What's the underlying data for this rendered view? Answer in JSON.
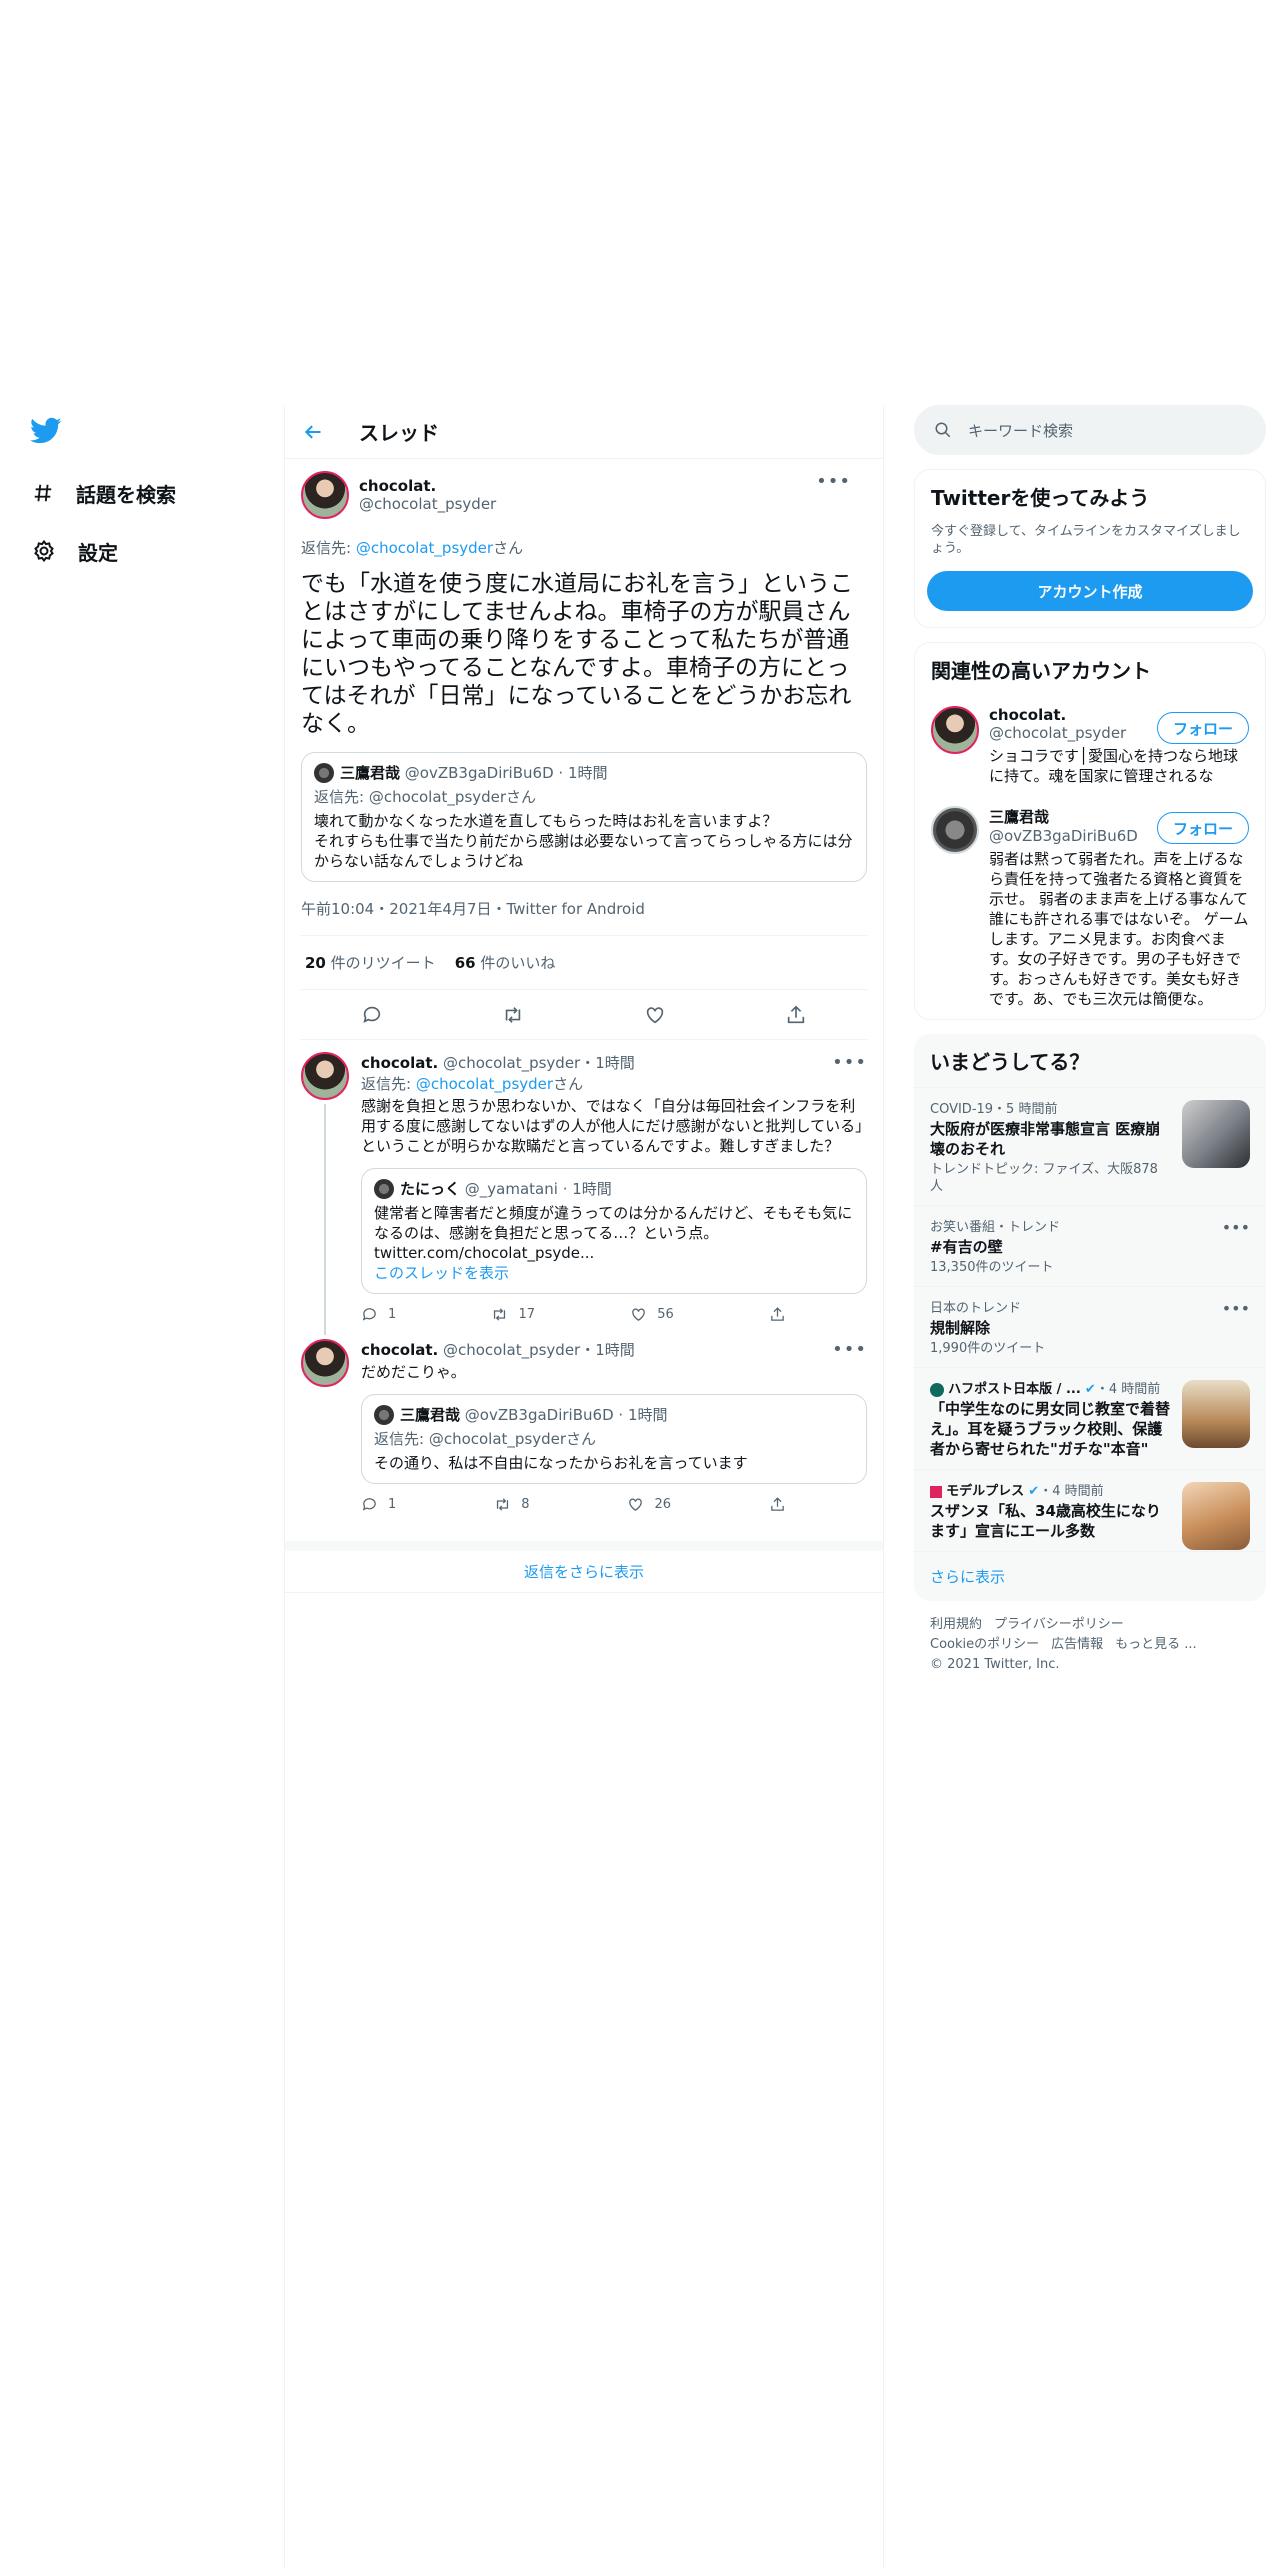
{
  "nav": {
    "explore": "話題を検索",
    "settings": "設定"
  },
  "header": {
    "title": "スレッド"
  },
  "main_tweet": {
    "name": "chocolat.",
    "handle": "@chocolat_psyder",
    "reply_prefix": "返信先: ",
    "reply_to": "@chocolat_psyder",
    "reply_suffix": "さん",
    "text": "でも「水道を使う度に水道局にお礼を言う」ということはさすがにしてませんよね。車椅子の方が駅員さんによって車両の乗り降りをすることって私たちが普通にいつもやってることなんですよ。車椅子の方にとってはそれが「日常」になっていることをどうかお忘れなく。",
    "quote": {
      "name": "三鷹君哉",
      "handle": "@ovZB3gaDiriBu6D",
      "time": "1時間",
      "reply_line": "返信先: @chocolat_psyderさん",
      "text": "壊れて動かなくなった水道を直してもらった時はお礼を言いますよ？\nそれすらも仕事で当たり前だから感謝は必要ないって言ってらっしゃる方には分からない話なんでしょうけどね"
    },
    "meta": "午前10:04・2021年4月7日・Twitter for Android",
    "retweets": "20",
    "retweets_label": " 件のリツイート",
    "likes": "66",
    "likes_label": " 件のいいね"
  },
  "replies": [
    {
      "name": "chocolat.",
      "handle": "@chocolat_psyder",
      "time": "・1時間",
      "reply_prefix": "返信先: ",
      "reply_to": "@chocolat_psyder",
      "reply_suffix": "さん",
      "text": "感謝を負担と思うか思わないか、ではなく「自分は毎回社会インフラを利用する度に感謝してないはずの人が他人にだけ感謝がないと批判している」ということが明らかな欺瞞だと言っているんですよ。難しすぎました？",
      "quote": {
        "name": "たにっく",
        "handle": "@_yamatani",
        "time": "1時間",
        "text": "健常者と障害者だと頻度が違うってのは分かるんだけど、そもそも気になるのは、感謝を負担だと思ってる…？という点。",
        "link": "twitter.com/chocolat_psyde...",
        "show_thread": "このスレッドを表示"
      },
      "reply_count": "1",
      "retweet_count": "17",
      "like_count": "56"
    },
    {
      "name": "chocolat.",
      "handle": "@chocolat_psyder",
      "time": "・1時間",
      "text": "だめだこりゃ。",
      "quote": {
        "name": "三鷹君哉",
        "handle": "@ovZB3gaDiriBu6D",
        "time": "1時間",
        "reply_line": "返信先: @chocolat_psyderさん",
        "text": "その通り、私は不自由になったからお礼を言っています"
      },
      "reply_count": "1",
      "retweet_count": "8",
      "like_count": "26"
    }
  ],
  "more_replies": "返信をさらに表示",
  "search": {
    "placeholder": "キーワード検索"
  },
  "signup": {
    "title": "Twitterを使ってみよう",
    "desc": "今すぐ登録して、タイムラインをカスタマイズしましょう。",
    "button": "アカウント作成"
  },
  "related": {
    "title": "関連性の高いアカウント",
    "follow": "フォロー",
    "accounts": [
      {
        "name": "chocolat.",
        "handle": "@chocolat_psyder",
        "bio": "ショコラです│愛国心を持つなら地球に持て。魂を国家に管理されるな"
      },
      {
        "name": "三鷹君哉",
        "handle": "@ovZB3gaDiriBu6D",
        "bio": "弱者は黙って弱者たれ。声を上げるなら責任を持って強者たる資格と資質を示せ。 弱者のまま声を上げる事なんて誰にも許される事ではないぞ。 ゲームします。アニメ見ます。お肉食べます。女の子好きです。男の子も好きです。おっさんも好きです。美女も好きです。あ、でも三次元は簡便な。"
      }
    ]
  },
  "trends": {
    "title": "いまどうしてる？",
    "items": [
      {
        "ctx": "COVID-19・5 時間前",
        "title": "大阪府が医療非常事態宣言 医療崩壊のおそれ",
        "sub": "トレンドトピック: ファイズ、大阪878人"
      },
      {
        "ctx": "お笑い番組・トレンド",
        "title": "#有吉の壁",
        "sub": "13,350件のツイート"
      },
      {
        "ctx": "日本のトレンド",
        "title": "規制解除",
        "sub": "1,990件のツイート"
      },
      {
        "ctx": "ハフポスト日本版 / ...",
        "time": "・4 時間前",
        "title": "「中学生なのに男女同じ教室で着替え」。耳を疑うブラック校則、保護者から寄せられた\"ガチな\"本音\""
      },
      {
        "ctx": "モデルプレス",
        "time": "・4 時間前",
        "title": "スザンヌ「私、34歳高校生になります」宣言にエール多数"
      }
    ],
    "show_more": "さらに表示"
  },
  "footer": {
    "links1": [
      "利用規約",
      "プライバシーポリシー"
    ],
    "links2": [
      "Cookieのポリシー",
      "広告情報",
      "もっと見る ..."
    ],
    "copyright": "© 2021 Twitter, Inc."
  },
  "colors": {
    "accent": "#1d9bf0",
    "like": "#e0245e"
  }
}
